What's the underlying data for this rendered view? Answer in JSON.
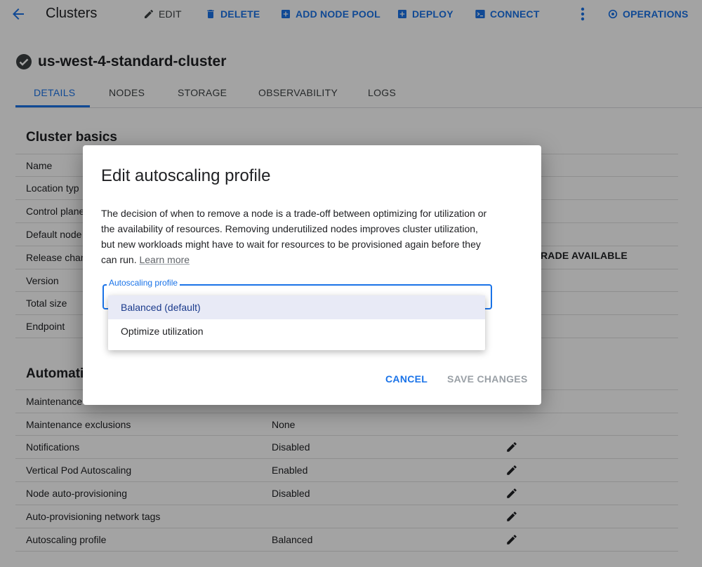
{
  "toolbar": {
    "title": "Clusters",
    "edit": "EDIT",
    "delete": "DELETE",
    "add_node_pool": "ADD NODE POOL",
    "deploy": "DEPLOY",
    "connect": "CONNECT",
    "operations": "OPERATIONS"
  },
  "cluster": {
    "name": "us-west-4-standard-cluster",
    "status_icon": "check-circle-icon"
  },
  "tabs": [
    {
      "label": "DETAILS",
      "active": true
    },
    {
      "label": "NODES"
    },
    {
      "label": "STORAGE"
    },
    {
      "label": "OBSERVABILITY"
    },
    {
      "label": "LOGS"
    }
  ],
  "basics": {
    "title": "Cluster basics",
    "rows": [
      {
        "label": "Name"
      },
      {
        "label": "Location typ"
      },
      {
        "label": "Control plane"
      },
      {
        "label": "Default node"
      },
      {
        "label": "Release chan"
      },
      {
        "label": "Version"
      },
      {
        "label": "Total size"
      },
      {
        "label": "Endpoint"
      }
    ],
    "upgrade_fragment": "RADE AVAILABLE"
  },
  "automation": {
    "title": "Automati",
    "rows": [
      {
        "label": "Maintenance",
        "value": ""
      },
      {
        "label": "Maintenance exclusions",
        "value": "None"
      },
      {
        "label": "Notifications",
        "value": "Disabled"
      },
      {
        "label": "Vertical Pod Autoscaling",
        "value": "Enabled"
      },
      {
        "label": "Node auto-provisioning",
        "value": "Disabled"
      },
      {
        "label": "Auto-provisioning network tags",
        "value": ""
      },
      {
        "label": "Autoscaling profile",
        "value": "Balanced"
      }
    ]
  },
  "dialog": {
    "title": "Edit autoscaling profile",
    "body": "The decision of when to remove a node is a trade-off between optimizing for utilization or the availability of resources. Removing underutilized nodes improves cluster utilization, but new workloads might have to wait for resources to be provisioned again before they can run.",
    "learn_more": "Learn more",
    "select_label": "Autoscaling profile",
    "options": [
      "Balanced (default)",
      "Optimize utilization"
    ],
    "selected_index": 0,
    "cancel": "CANCEL",
    "save": "SAVE CHANGES"
  },
  "colors": {
    "accent": "#1a73e8",
    "selected_bg": "#e8eaf6",
    "disabled": "#9aa0a6"
  }
}
